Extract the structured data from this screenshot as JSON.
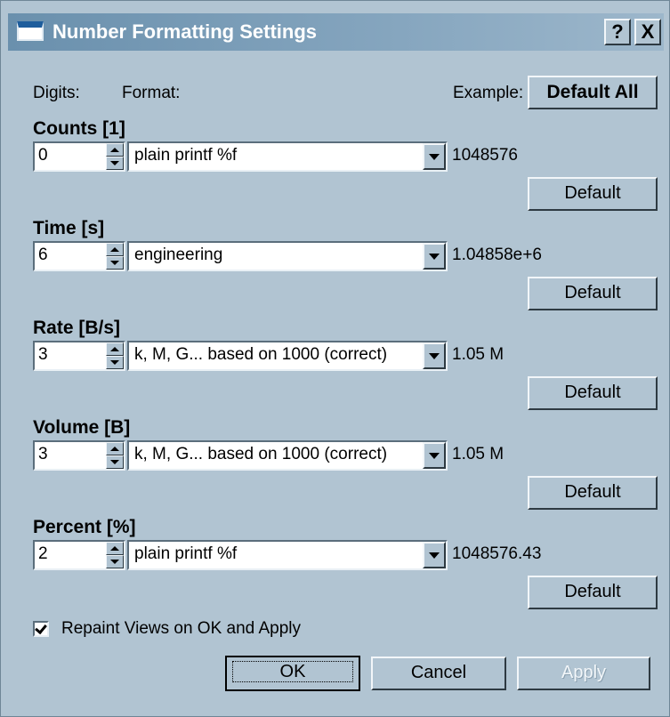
{
  "window": {
    "title": "Number Formatting Settings",
    "help_label": "?",
    "close_label": "X"
  },
  "header": {
    "digits_label": "Digits:",
    "format_label": "Format:",
    "example_label": "Example:",
    "default_all_label": "Default All"
  },
  "sections": [
    {
      "title": "Counts [1]",
      "digits": "0",
      "format": "plain printf %f",
      "example": "1048576",
      "default_label": "Default"
    },
    {
      "title": "Time [s]",
      "digits": "6",
      "format": "engineering",
      "example": "1.04858e+6",
      "default_label": "Default"
    },
    {
      "title": "Rate [B/s]",
      "digits": "3",
      "format": "k, M, G... based on 1000 (correct)",
      "example": "1.05 M",
      "default_label": "Default"
    },
    {
      "title": "Volume [B]",
      "digits": "3",
      "format": "k, M, G... based on 1000 (correct)",
      "example": "1.05 M",
      "default_label": "Default"
    },
    {
      "title": "Percent [%]",
      "digits": "2",
      "format": "plain printf %f",
      "example": "1048576.43",
      "default_label": "Default"
    }
  ],
  "repaint": {
    "label": "Repaint Views on OK and Apply",
    "checked": true
  },
  "footer": {
    "ok_label": "OK",
    "cancel_label": "Cancel",
    "apply_label": "Apply"
  },
  "colors": {
    "dialog_bg": "#b1c4d2",
    "titlebar": "#6a90ad"
  }
}
